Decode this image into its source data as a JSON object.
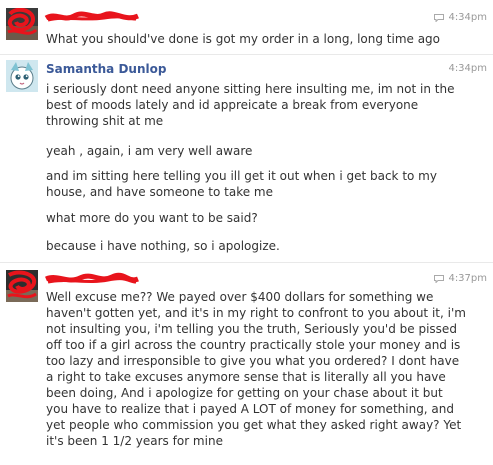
{
  "conversation": {
    "message_1": {
      "time": "4:34pm",
      "lines": [
        "What you should've done is got my order in a long, long time ago"
      ]
    },
    "message_2": {
      "sender": "Samantha Dunlop",
      "time": "4:34pm",
      "paragraphs": [
        [
          "i seriously dont need anyone sitting here insulting me, im not in the",
          "best of moods lately and id appreicate a break from everyone",
          "throwing shit at me"
        ],
        [
          "yeah , again, i am very well aware"
        ],
        [
          "and im sitting here telling you ill get it out when i get back to my",
          "house, and have someone to take me"
        ],
        [
          "what more do you want to be said?"
        ],
        [
          "because i have nothing, so i apologize."
        ]
      ]
    },
    "message_3": {
      "time": "4:37pm",
      "lines": [
        "Well excuse me?? We payed over $400 dollars for something we",
        "haven't gotten yet, and it's in my right to confront to you about it, i'm",
        "not insulting you, i'm telling you the truth, Seriously you'd be pissed",
        "off too if a girl across the country practically stole your money and is",
        "too lazy and irresponsible to give you what you ordered? I dont have",
        "a right to take excuses anymore sense that is literally all you have",
        "been doing, And i apologize for getting on your chase about it but",
        "you have to realize that i payed A LOT of money for something, and",
        "yet people who commission you get what they asked right away? Yet",
        "it's been 1 1/2 years for mine"
      ]
    }
  },
  "icons": {
    "timestamp": "chat-bubble-icon",
    "avatar_1": "redacted-avatar",
    "avatar_2": "samantha-avatar",
    "avatar_3": "redacted-avatar"
  },
  "colors": {
    "sender_name": "#3b5998",
    "redaction": "#e8141c",
    "timestamp": "#999999"
  }
}
